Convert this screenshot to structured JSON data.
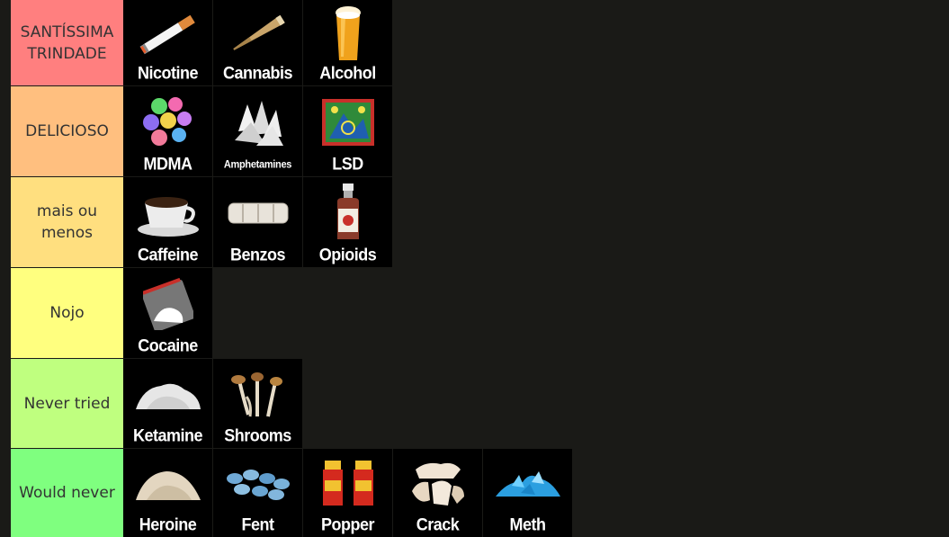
{
  "tiers": [
    {
      "label": "SANTÍSSIMA TRINDADE",
      "color": "#ff7f7f",
      "items": [
        {
          "name": "Nicotine",
          "icon": "cigarette-icon"
        },
        {
          "name": "Cannabis",
          "icon": "joint-icon"
        },
        {
          "name": "Alcohol",
          "icon": "beer-glass-icon"
        }
      ]
    },
    {
      "label": "DELICIOSO",
      "color": "#ffbf7f",
      "items": [
        {
          "name": "MDMA",
          "icon": "pills-icon"
        },
        {
          "name": "Amphetamines",
          "icon": "crystals-icon"
        },
        {
          "name": "LSD",
          "icon": "blotter-icon"
        }
      ]
    },
    {
      "label": "mais ou menos",
      "color": "#ffdf7f",
      "items": [
        {
          "name": "Caffeine",
          "icon": "coffee-cup-icon"
        },
        {
          "name": "Benzos",
          "icon": "xanax-bar-icon"
        },
        {
          "name": "Opioids",
          "icon": "syrup-bottle-icon"
        }
      ]
    },
    {
      "label": "Nojo",
      "color": "#ffff7f",
      "items": [
        {
          "name": "Cocaine",
          "icon": "powder-bag-icon"
        }
      ]
    },
    {
      "label": "Never tried",
      "color": "#bfff7f",
      "items": [
        {
          "name": "Ketamine",
          "icon": "powder-pile-icon"
        },
        {
          "name": "Shrooms",
          "icon": "mushrooms-icon"
        }
      ]
    },
    {
      "label": "Would never",
      "color": "#7fff7f",
      "items": [
        {
          "name": "Heroine",
          "icon": "beige-powder-icon"
        },
        {
          "name": "Fent",
          "icon": "blue-pills-icon"
        },
        {
          "name": "Popper",
          "icon": "popper-bottles-icon"
        },
        {
          "name": "Crack",
          "icon": "rocks-icon"
        },
        {
          "name": "Meth",
          "icon": "blue-crystals-icon"
        }
      ]
    }
  ]
}
